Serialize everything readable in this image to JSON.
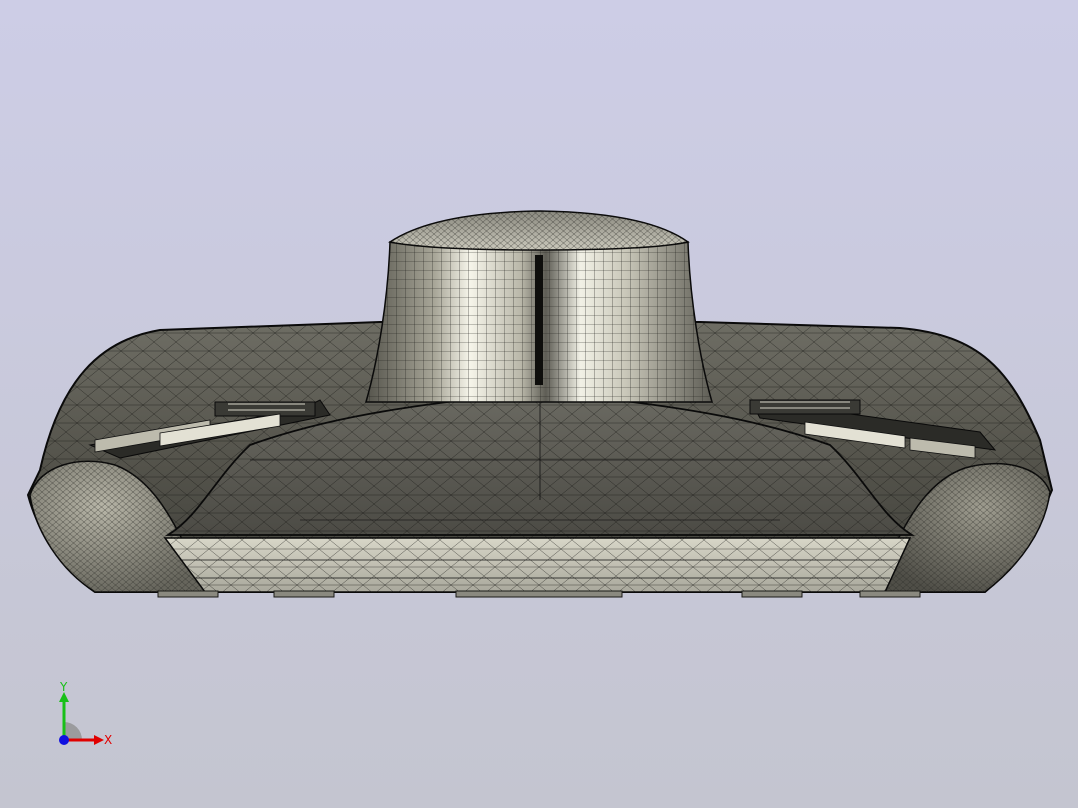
{
  "viewport": {
    "background_top": "#CDCDE6",
    "background_bottom": "#C4C5D0",
    "model": {
      "shaded_colors": {
        "dark_shell": "#57574F",
        "mid_shell": "#8E8D82",
        "light_face": "#CFCDBE",
        "highlight": "#F6F5EA",
        "edge": "#0A0A0A"
      }
    },
    "triad": {
      "x_label": "X",
      "y_label": "Y",
      "x_color": "#E00000",
      "y_color": "#18C018",
      "z_color": "#1010E0"
    }
  }
}
